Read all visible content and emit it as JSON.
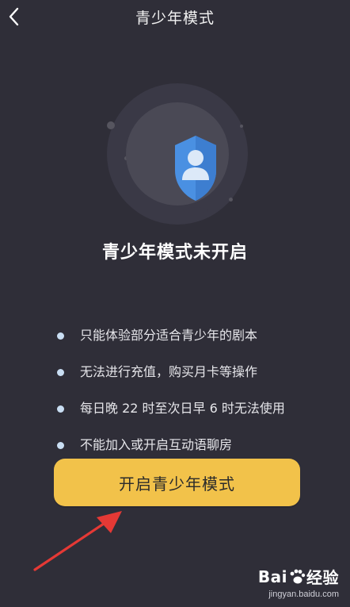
{
  "header": {
    "title": "青少年模式",
    "back_icon": "chevron-left-icon"
  },
  "hero": {
    "icon": "shield-user-icon",
    "status": "青少年模式未开启"
  },
  "rules": [
    "只能体验部分适合青少年的剧本",
    "无法进行充值，购买月卡等操作",
    "每日晚 22 时至次日早 6 时无法使用",
    "不能加入或开启互动语聊房"
  ],
  "cta": {
    "label": "开启青少年模式"
  },
  "watermark": {
    "logo_left": "Bai",
    "logo_right": "经验",
    "url": "jingyan.baidu.com"
  },
  "colors": {
    "background": "#2f2e38",
    "accent": "#f2c24a",
    "shield": "#4a90e2",
    "arrow": "#e53935"
  }
}
